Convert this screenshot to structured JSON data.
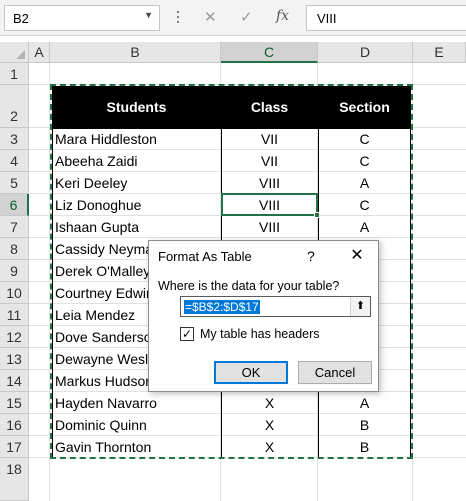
{
  "formula_bar": {
    "name_box": "B2",
    "formula": "VIII",
    "cancel_symbol": "✕",
    "enter_symbol": "✓",
    "function_symbol": "fx"
  },
  "columns": [
    "A",
    "B",
    "C",
    "D",
    "E"
  ],
  "rows": [
    "1",
    "2",
    "3",
    "4",
    "5",
    "6",
    "7",
    "8",
    "9",
    "10",
    "11",
    "12",
    "13",
    "14",
    "15",
    "16",
    "17",
    "18"
  ],
  "table": {
    "headers": [
      "Students",
      "Class",
      "Section"
    ],
    "records": [
      [
        "Mara Hiddleston",
        "VII",
        "C"
      ],
      [
        "Abeeha Zaidi",
        "VII",
        "C"
      ],
      [
        "Keri Deeley",
        "VIII",
        "A"
      ],
      [
        "Liz Donoghue",
        "VIII",
        "C"
      ],
      [
        "Ishaan Gupta",
        "VIII",
        "A"
      ],
      [
        "Cassidy Neyma",
        "",
        ""
      ],
      [
        "Derek O'Malley",
        "",
        ""
      ],
      [
        "Courtney Edwin",
        "",
        ""
      ],
      [
        "Leia Mendez",
        "",
        ""
      ],
      [
        "Dove Sanderso",
        "",
        ""
      ],
      [
        "Dewayne Wesl",
        "",
        ""
      ],
      [
        "Markus Hudson",
        "",
        ""
      ],
      [
        "Hayden Navarro",
        "X",
        "A"
      ],
      [
        "Dominic Quinn",
        "X",
        "B"
      ],
      [
        "Gavin Thornton",
        "X",
        "B"
      ]
    ]
  },
  "dialog": {
    "title": "Format As Table",
    "help": "?",
    "close": "✕",
    "prompt": "Where is the data for your table?",
    "range_value": "=$B$2:$D$17",
    "collapse_icon": "⬆",
    "has_headers_label": "My table has headers",
    "has_headers_checked": true,
    "check_mark": "✓",
    "ok_label": "OK",
    "cancel_label": "Cancel"
  },
  "colors": {
    "accent_green": "#217346",
    "header_fill": "#000000",
    "header_text": "#ffffff",
    "focus_blue": "#0078d7"
  }
}
